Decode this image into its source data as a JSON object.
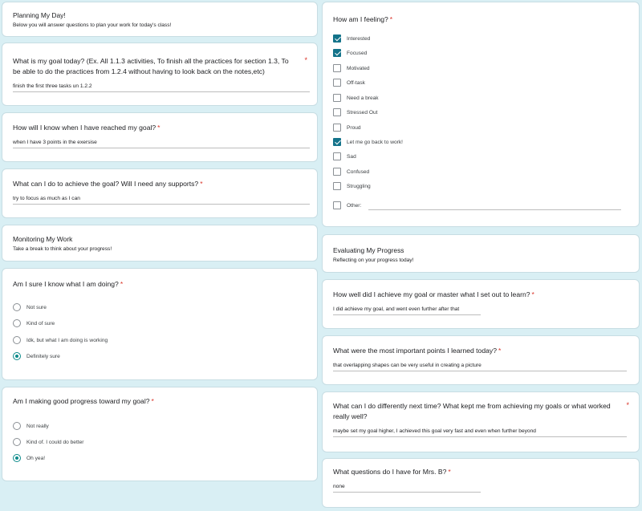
{
  "left": {
    "planning": {
      "title": "Planning My Day!",
      "desc": "Below you will answer questions to plan your work for today's class!"
    },
    "goal": {
      "question": "What is my goal today? (Ex. All 1.1.3 activities, To finish all the practices for section 1.3, To be able to do the practices from 1.2.4 without having to look back on the notes,etc)",
      "required": "*",
      "answer": "finish the first three tasks un 1.2.2"
    },
    "reached": {
      "question": "How will I know when I have reached my goal?",
      "required": "*",
      "answer": "when I have 3 points in the exersise"
    },
    "achieve": {
      "question": "What can I do to achieve the goal? Will I need any supports?",
      "required": "*",
      "answer": "try to focus as much as I can"
    },
    "monitoring": {
      "title": "Monitoring My Work",
      "desc": "Take a break to think about your progress!"
    },
    "sure": {
      "question": "Am I sure I know what I am doing?",
      "required": "*",
      "options": [
        "Not sure",
        "Kind of sure",
        "Idk, but what I am doing is working",
        "Definitely sure"
      ],
      "selected": "Definitely sure"
    },
    "progress": {
      "question": "Am I making good progress toward my goal?",
      "required": "*",
      "options": [
        "Not really",
        "Kind of. I could do better",
        "Oh yea!"
      ],
      "selected": "Oh yea!"
    }
  },
  "right": {
    "feeling": {
      "question": "How am I feeling?",
      "required": "*",
      "options": [
        "Interested",
        "Focused",
        "Motivated",
        "Off-task",
        "Need a break",
        "Stressed Out",
        "Proud",
        "Let me go back to work!",
        "Sad",
        "Confused",
        "Struggling"
      ],
      "checked": [
        "Interested",
        "Focused",
        "Let me go back to work!"
      ],
      "other_label": "Other:"
    },
    "evaluating": {
      "title": "Evaluating My Progress",
      "desc": "Reflecting on your progress today!"
    },
    "how_well": {
      "question": "How well did I achieve my goal or master what I set out to learn?",
      "required": "*",
      "answer": "I did achieve my goal, and went even further after that"
    },
    "important": {
      "question": "What were the most important points I learned today?",
      "required": "*",
      "answer": "that overlapping shapes can be very useful in creating a picture"
    },
    "differently": {
      "question": "What can I do differently next time? What kept me from achieving my goals or what worked really well?",
      "required": "*",
      "answer": "maybe set my goal higher, I achieved this goal very fast and even when further beyond"
    },
    "questions": {
      "question": "What questions do I have for Mrs. B?",
      "required": "*",
      "answer": "none"
    }
  },
  "colors": {
    "page_bg": "#d9eff4",
    "accent": "#0b8a8a",
    "required": "#d93025"
  }
}
